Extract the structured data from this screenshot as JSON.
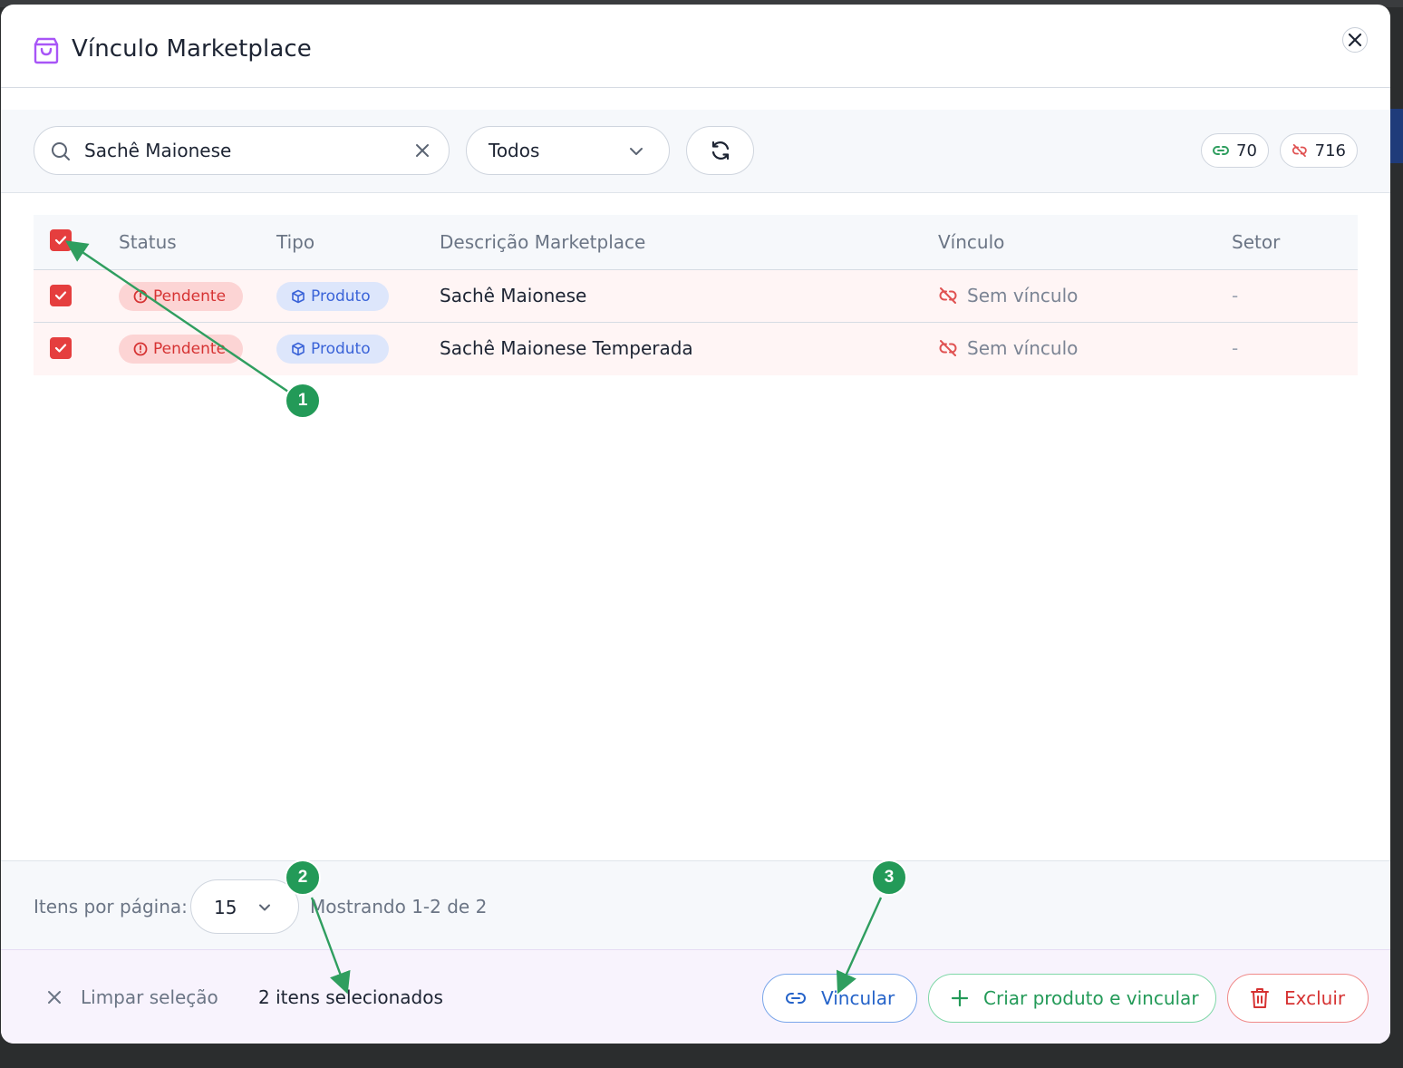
{
  "dialog": {
    "title": "Vínculo Marketplace"
  },
  "toolbar": {
    "search_value": "Sachê Maionese",
    "filter_value": "Todos",
    "linked_count": "70",
    "unlinked_count": "716"
  },
  "table": {
    "headers": {
      "status": "Status",
      "tipo": "Tipo",
      "descricao": "Descrição Marketplace",
      "vinculo": "Vínculo",
      "setor": "Setor"
    },
    "rows": [
      {
        "checked": true,
        "status": "Pendente",
        "tipo": "Produto",
        "descricao": "Sachê Maionese",
        "vinculo": "Sem vínculo",
        "setor": "-"
      },
      {
        "checked": true,
        "status": "Pendente",
        "tipo": "Produto",
        "descricao": "Sachê Maionese Temperada",
        "vinculo": "Sem vínculo",
        "setor": "-"
      }
    ]
  },
  "pagination": {
    "per_page_label": "Itens por página:",
    "per_page_value": "15",
    "showing": "Mostrando 1-2 de 2"
  },
  "selection_bar": {
    "clear_label": "Limpar seleção",
    "selected_count": "2 itens selecionados",
    "link_label": "Vincular",
    "create_label": "Criar produto e vincular",
    "delete_label": "Excluir"
  },
  "annotations": {
    "marker_1": "1",
    "marker_2": "2",
    "marker_3": "3"
  },
  "colors": {
    "accent_red": "#e53e3e",
    "status_pending_bg": "#fcd4d4",
    "type_product_bg": "#dde6fb",
    "link_blue": "#2563c9",
    "create_green": "#239a58",
    "annotation_green": "#239a58",
    "header_icon_purple": "#a855f7"
  }
}
